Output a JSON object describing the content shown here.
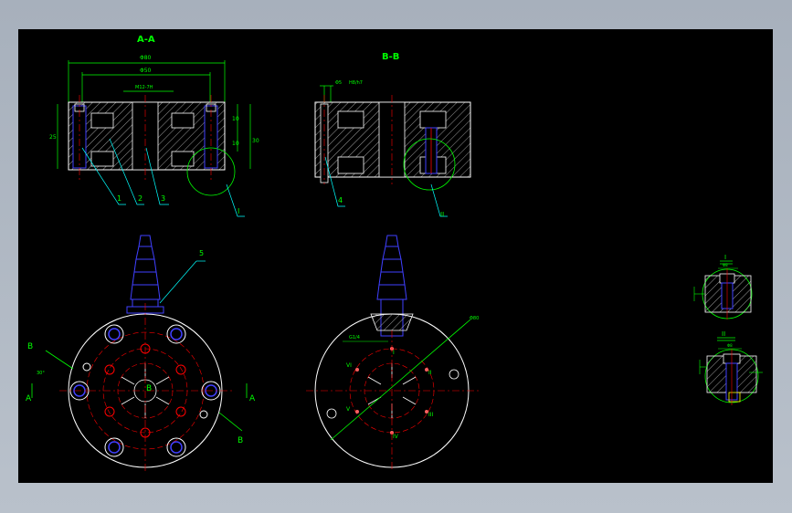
{
  "drawing": {
    "section_aa_title": "A-A",
    "section_bb_title": "B-B",
    "dims_aa": {
      "d1": "Φ80",
      "d2": "Φ50",
      "thread": "M12-7H",
      "h_left": "25",
      "h_right1": "10",
      "h_right2": "10",
      "h_right3": "30"
    },
    "dims_bb": {
      "d1": "Φ5",
      "fit": "H8/h7"
    },
    "part_numbers": [
      "1",
      "2",
      "3",
      "4",
      "5"
    ],
    "detail_refs": [
      "I",
      "II"
    ],
    "plan_labels": {
      "a_left": "A",
      "a_right": "A",
      "b_left": "B",
      "b_right": "B",
      "center": "B",
      "angle": "30°"
    },
    "right_plan": {
      "dia": "Φ80",
      "thread": "G1/4",
      "roman": [
        "I",
        "II",
        "III",
        "IV",
        "V",
        "VI"
      ]
    },
    "detail_1": {
      "title": "I",
      "dim": "Φ8"
    },
    "detail_2": {
      "title": "II",
      "dim": "Φ8"
    }
  },
  "colors": {
    "background": "#000000",
    "outline": "#ffffff",
    "dimension": "#00ff00",
    "leader": "#00ffff",
    "centerline": "#ff0000",
    "hidden": "#4040ff",
    "hatch": "#c0c0c0",
    "label_text": "#00ff00"
  }
}
